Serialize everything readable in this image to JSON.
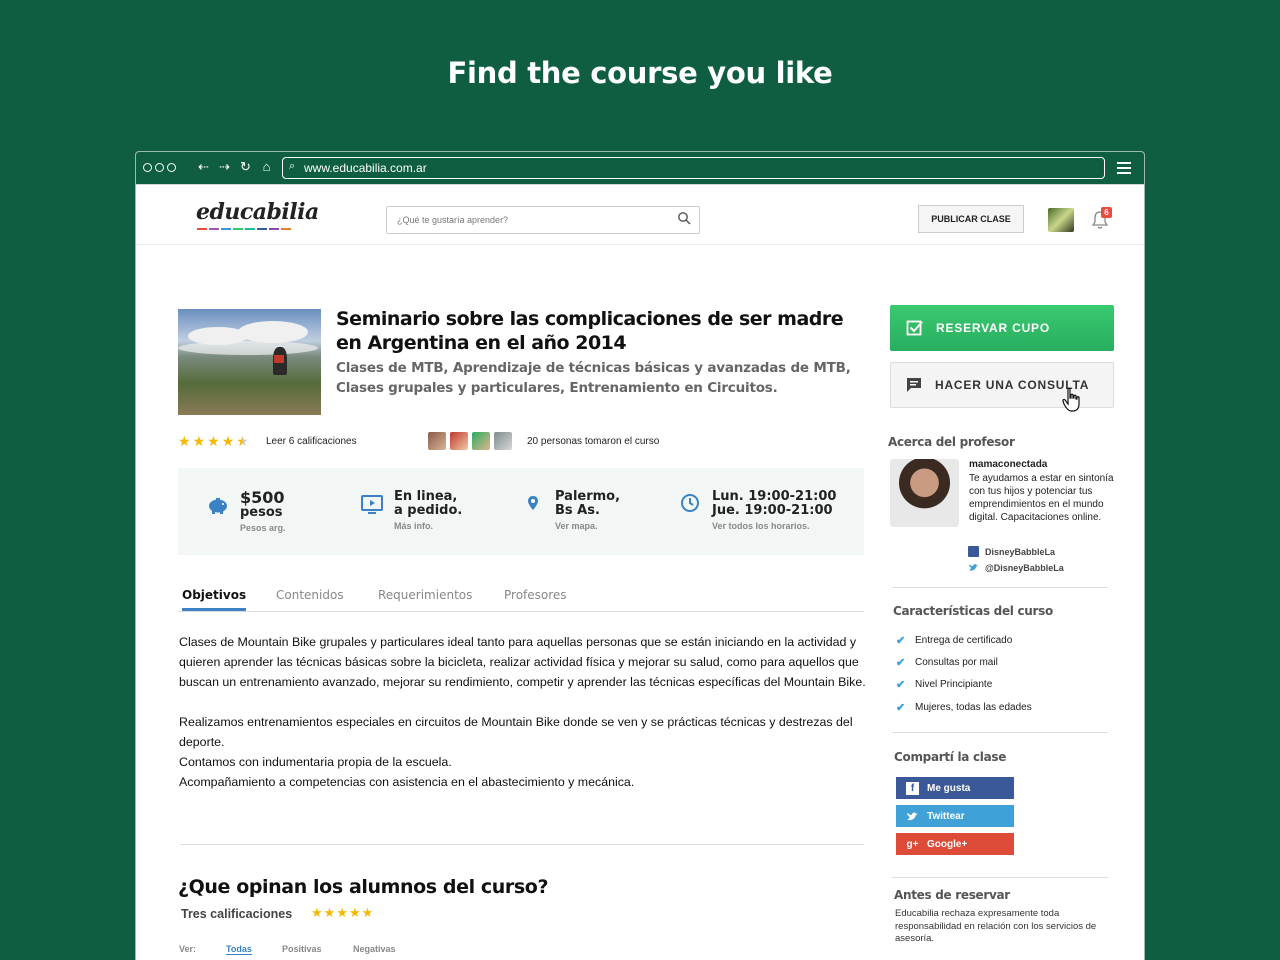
{
  "headline": "Find the course you like",
  "browser": {
    "url": "www.educabilia.com.ar"
  },
  "header": {
    "logo": "educabilia",
    "search_placeholder": "¿Qué te gustaría aprender?",
    "publish_button": "PUBLICAR CLASE",
    "notifications_count": "6"
  },
  "course": {
    "title": "Seminario sobre las complicaciones de ser madre en Argentina en el año 2014",
    "subtitle": "Clases de MTB, Aprendizaje de técnicas básicas y avanzadas de MTB, Clases grupales y particulares, Entrenamiento en Circuitos.",
    "rating": 4.5,
    "ratings_link": "Leer 6 calificaciones",
    "students_text": "20 personas tomaron el curso",
    "info": {
      "price": "$500",
      "price_unit": "pesos",
      "price_note": "Pesos arg.",
      "mode_line1": "En linea,",
      "mode_line2": "a pedido.",
      "mode_note": "Más info.",
      "location_line1": "Palermo,",
      "location_line2": "Bs As.",
      "location_note": "Ver mapa.",
      "schedule_line1": "Lun. 19:00-21:00",
      "schedule_line2": "Jue. 19:00-21:00",
      "schedule_note": "Ver todos los horarios."
    },
    "tabs": [
      "Objetivos",
      "Contenidos",
      "Requerimientos",
      "Profesores"
    ],
    "active_tab": "Objetivos",
    "body": {
      "p1": "Clases de Mountain Bike grupales y particulares ideal tanto para aquellas personas que se están iniciando en la actividad y quieren aprender las técnicas básicas sobre la bicicleta, realizar actividad física y mejorar su salud, como para aquellos que buscan un entrenamiento avanzado, mejorar su rendimiento, competir y aprender las técnicas específicas del Mountain Bike.",
      "p2": "Realizamos entrenamientos especiales en circuitos de Mountain Bike donde se ven y se prácticas técnicas y destrezas del deporte.",
      "p3": "Contamos con indumentaria propia de la escuela.",
      "p4": "Acompañamiento a competencias con asistencia en el abastecimiento y mecánica."
    }
  },
  "reviews": {
    "title": "¿Que opinan los alumnos del curso?",
    "count_text": "Tres calificaciones",
    "rating": 5,
    "filter_label": "Ver:",
    "filters": [
      "Todas",
      "Positivas",
      "Negativas"
    ],
    "active_filter": "Todas"
  },
  "sidebar": {
    "reserve_button": "RESERVAR CUPO",
    "ask_button": "HACER UNA CONSULTA",
    "professor_heading": "Acerca del profesor",
    "professor_name": "mamaconectada",
    "professor_desc": "Te ayudamos a estar en sintonía con tus hijos y potenciar tus emprendimientos en el mundo digital. Capacitaciones online.",
    "facebook": "DisneyBabbleLa",
    "twitter": "@DisneyBabbleLa",
    "features_heading": "Características del curso",
    "features": [
      "Entrega de certificado",
      "Consultas por mail",
      "Nivel Principiante",
      "Mujeres, todas las edades"
    ],
    "share_heading": "Compartí la clase",
    "share_facebook": "Me gusta",
    "share_twitter": "Twittear",
    "share_google": "Google+",
    "before_heading": "Antes de reservar",
    "before_text": "Educabilia rechaza expresamente toda responsabilidad en relación con los servicios de asesoría."
  },
  "colors": {
    "background": "#0f5e42",
    "primary_green": "#2ecc71",
    "accent_blue": "#3b82c4",
    "star": "#f5b800",
    "facebook": "#3b5998",
    "twitter": "#3fa1d8",
    "google": "#dd4b39"
  }
}
